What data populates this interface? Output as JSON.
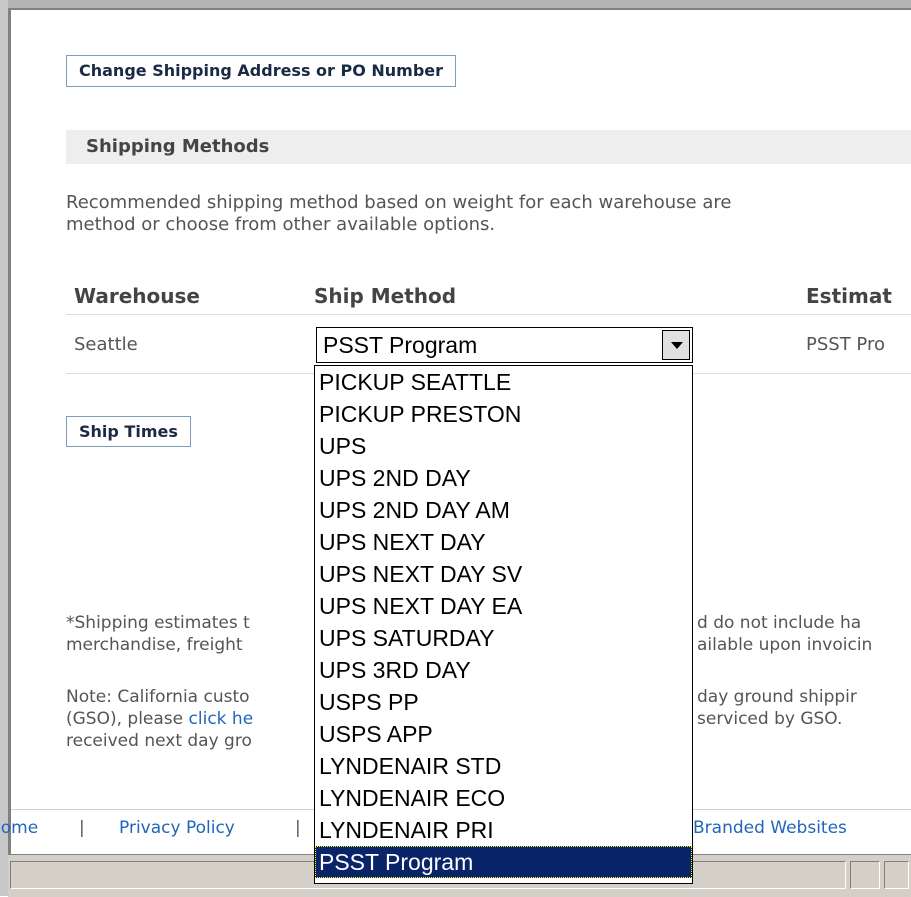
{
  "buttons": {
    "change_address": "Change Shipping Address or PO Number",
    "ship_times": "Ship Times"
  },
  "section": {
    "title": "Shipping Methods",
    "description_line1": "Recommended shipping method based on weight for each warehouse are",
    "description_line2": "method or choose from other available options."
  },
  "table": {
    "headers": [
      "Warehouse",
      "Ship Method",
      "Estimat"
    ],
    "row": {
      "warehouse": "Seattle",
      "ship_method": "PSST Program",
      "estimate": "PSST Pro"
    }
  },
  "dropdown": {
    "selected": "PSST Program",
    "options": [
      "PICKUP SEATTLE",
      "PICKUP PRESTON",
      "UPS",
      "UPS 2ND DAY",
      "UPS 2ND DAY AM",
      "UPS NEXT DAY",
      "UPS NEXT DAY SV",
      "UPS NEXT DAY EA",
      "UPS SATURDAY",
      "UPS 3RD DAY",
      "USPS PP",
      "USPS APP",
      "LYNDENAIR STD",
      "LYNDENAIR ECO",
      "LYNDENAIR PRI",
      "PSST Program"
    ],
    "selected_index": 15
  },
  "notes": {
    "shipping_left_1": "*Shipping estimates t",
    "shipping_right_1": "d do not include ha",
    "shipping_left_2": "merchandise, freight",
    "shipping_right_2": "ailable upon invoicin",
    "ca_left_1": "Note: California custo",
    "ca_right_1": "day ground shippir",
    "ca_left_2a": "(GSO), please",
    "ca_left_2_link": "click he",
    "ca_right_2": "serviced by GSO.",
    "ca_left_3": "received next day gro"
  },
  "footer": {
    "home": "Home",
    "privacy": "Privacy Policy",
    "separator": "|",
    "branded": "Branded Websites"
  }
}
